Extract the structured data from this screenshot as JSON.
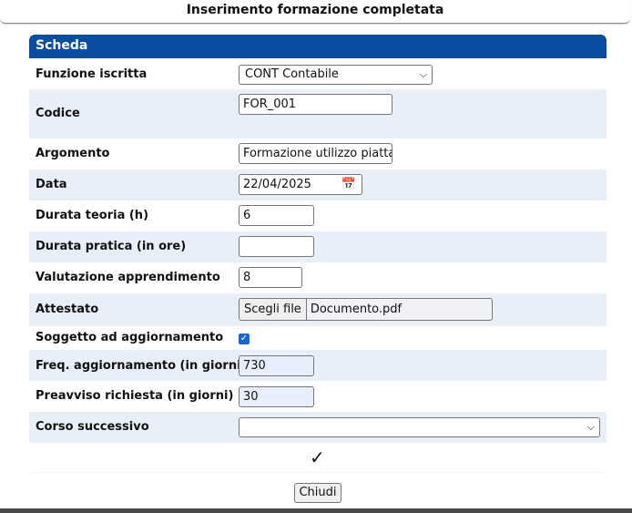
{
  "window": {
    "title": "Inserimento formazione completata"
  },
  "panel": {
    "header": "Scheda"
  },
  "fields": {
    "funzione": {
      "label": "Funzione iscritta",
      "value": "CONT Contabile"
    },
    "codice": {
      "label": "Codice",
      "value": "FOR_001"
    },
    "argomento": {
      "label": "Argomento",
      "value": "Formazione utilizzo piattaforma"
    },
    "data": {
      "label": "Data",
      "value": "22/04/2025"
    },
    "durata_teoria": {
      "label": "Durata teoria (h)",
      "value": "6"
    },
    "durata_pratica": {
      "label": "Durata pratica (in ore)",
      "value": ""
    },
    "valutazione": {
      "label": "Valutazione apprendimento",
      "value": "8"
    },
    "attestato": {
      "label": "Attestato",
      "button": "Scegli file",
      "file": "Documento.pdf"
    },
    "soggetto": {
      "label": "Soggetto ad aggiornamento",
      "checked": true
    },
    "freq": {
      "label": "Freq. aggiornamento (in giorni)",
      "value": "730"
    },
    "preavviso": {
      "label": "Preavviso richiesta (in giorni)",
      "value": "30"
    },
    "corso": {
      "label": "Corso successivo",
      "value": ""
    }
  },
  "actions": {
    "confirm_icon": "checkmark-icon",
    "close_label": "Chiudi"
  },
  "colors": {
    "header": "#0a4da2",
    "row_alt": "#e9eff8",
    "checkbox": "#1a67d2"
  }
}
